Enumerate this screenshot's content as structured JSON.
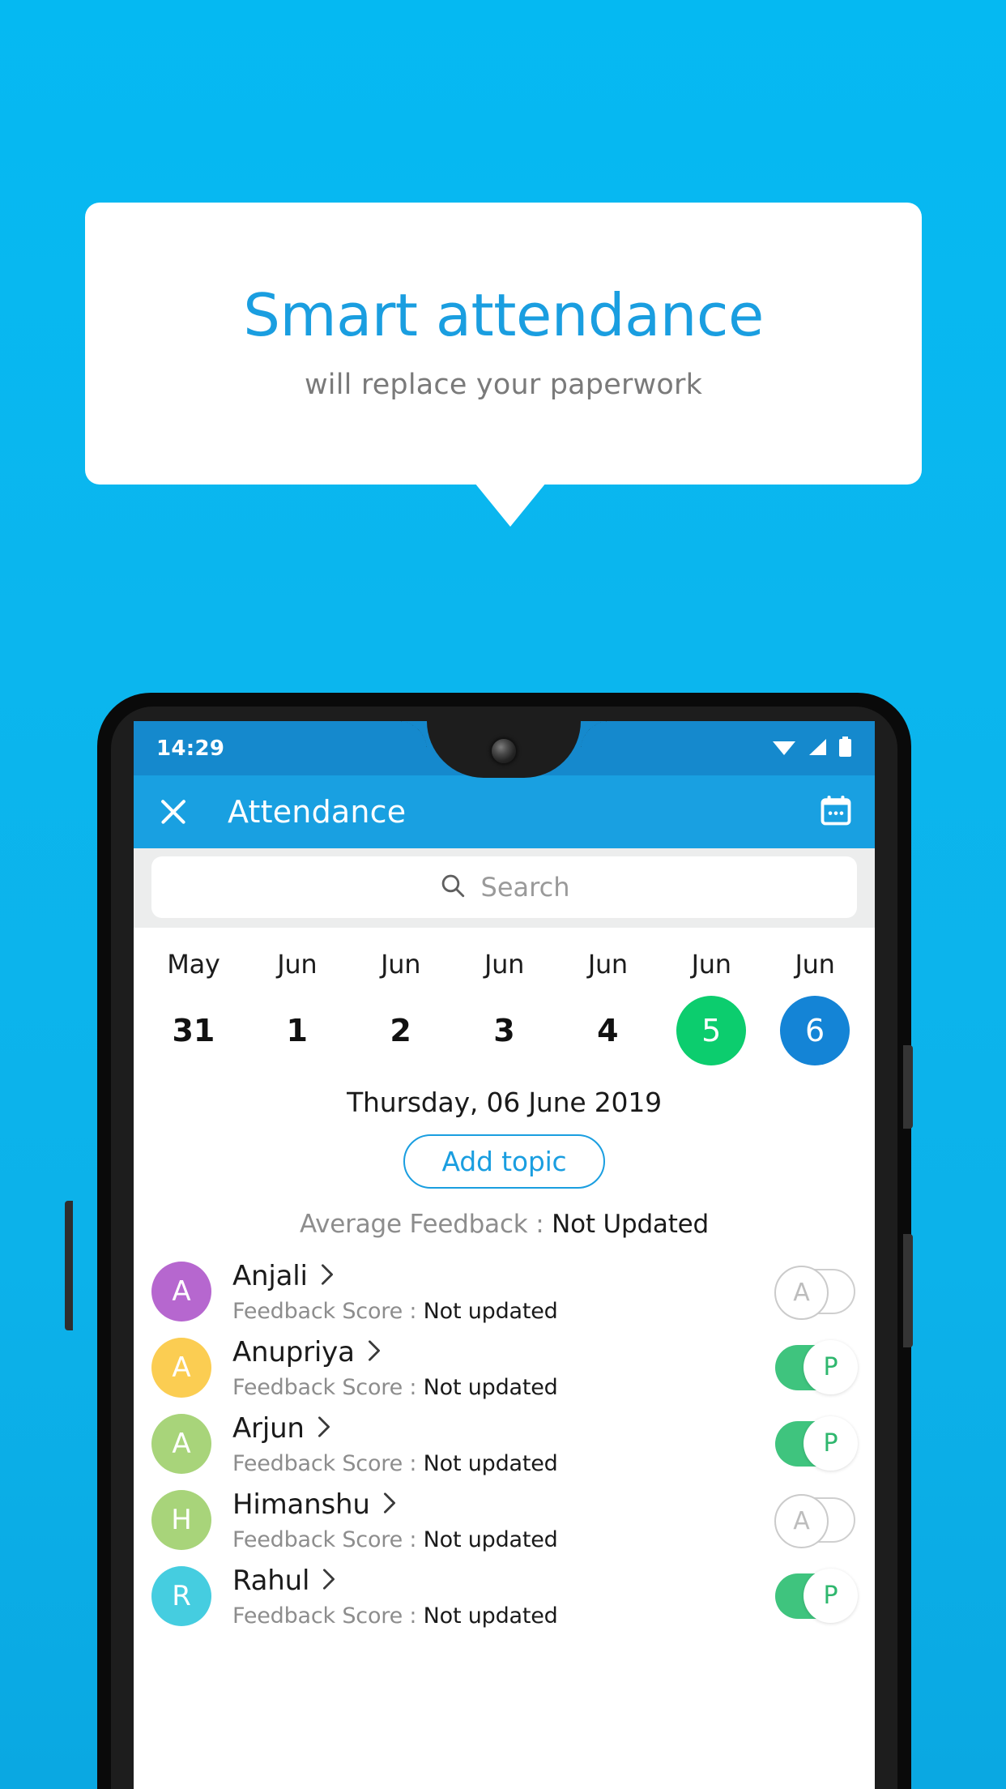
{
  "promo": {
    "title": "Smart attendance",
    "subtitle": "will replace your paperwork"
  },
  "colors": {
    "background": "#0cb8ef",
    "appbar": "#19a0e1",
    "statusbar": "#1589cd",
    "accent_blue": "#1a9ee0",
    "selected_green": "#0ccd6e",
    "selected_blue": "#1484d6",
    "toggle_on_green": "#3fc47e"
  },
  "phone": {
    "statusbar": {
      "time": "14:29",
      "icons": [
        "wifi-icon",
        "signal-icon",
        "battery-icon"
      ]
    },
    "appbar": {
      "close_icon": "close-icon",
      "title": "Attendance",
      "calendar_icon": "calendar-icon"
    },
    "search": {
      "icon": "search-icon",
      "placeholder": "Search",
      "value": ""
    },
    "date_strip": [
      {
        "month": "May",
        "day": "31",
        "state": "normal"
      },
      {
        "month": "Jun",
        "day": "1",
        "state": "normal"
      },
      {
        "month": "Jun",
        "day": "2",
        "state": "normal"
      },
      {
        "month": "Jun",
        "day": "3",
        "state": "normal"
      },
      {
        "month": "Jun",
        "day": "4",
        "state": "normal"
      },
      {
        "month": "Jun",
        "day": "5",
        "state": "green"
      },
      {
        "month": "Jun",
        "day": "6",
        "state": "blue"
      }
    ],
    "selected_date_label": "Thursday, 06 June 2019",
    "add_topic_label": "Add topic",
    "average_feedback": {
      "label": "Average Feedback : ",
      "value": "Not Updated"
    },
    "score_label": "Feedback Score : ",
    "students": [
      {
        "name": "Anjali",
        "initial": "A",
        "avatar_color": "#b667cf",
        "score": "Not updated",
        "attendance": "A",
        "toggle_on": false
      },
      {
        "name": "Anupriya",
        "initial": "A",
        "avatar_color": "#fbcd52",
        "score": "Not updated",
        "attendance": "P",
        "toggle_on": true
      },
      {
        "name": "Arjun",
        "initial": "A",
        "avatar_color": "#a8d47a",
        "score": "Not updated",
        "attendance": "P",
        "toggle_on": true
      },
      {
        "name": "Himanshu",
        "initial": "H",
        "avatar_color": "#a8d47a",
        "score": "Not updated",
        "attendance": "A",
        "toggle_on": false
      },
      {
        "name": "Rahul",
        "initial": "R",
        "avatar_color": "#45cde0",
        "score": "Not updated",
        "attendance": "P",
        "toggle_on": true
      }
    ]
  }
}
